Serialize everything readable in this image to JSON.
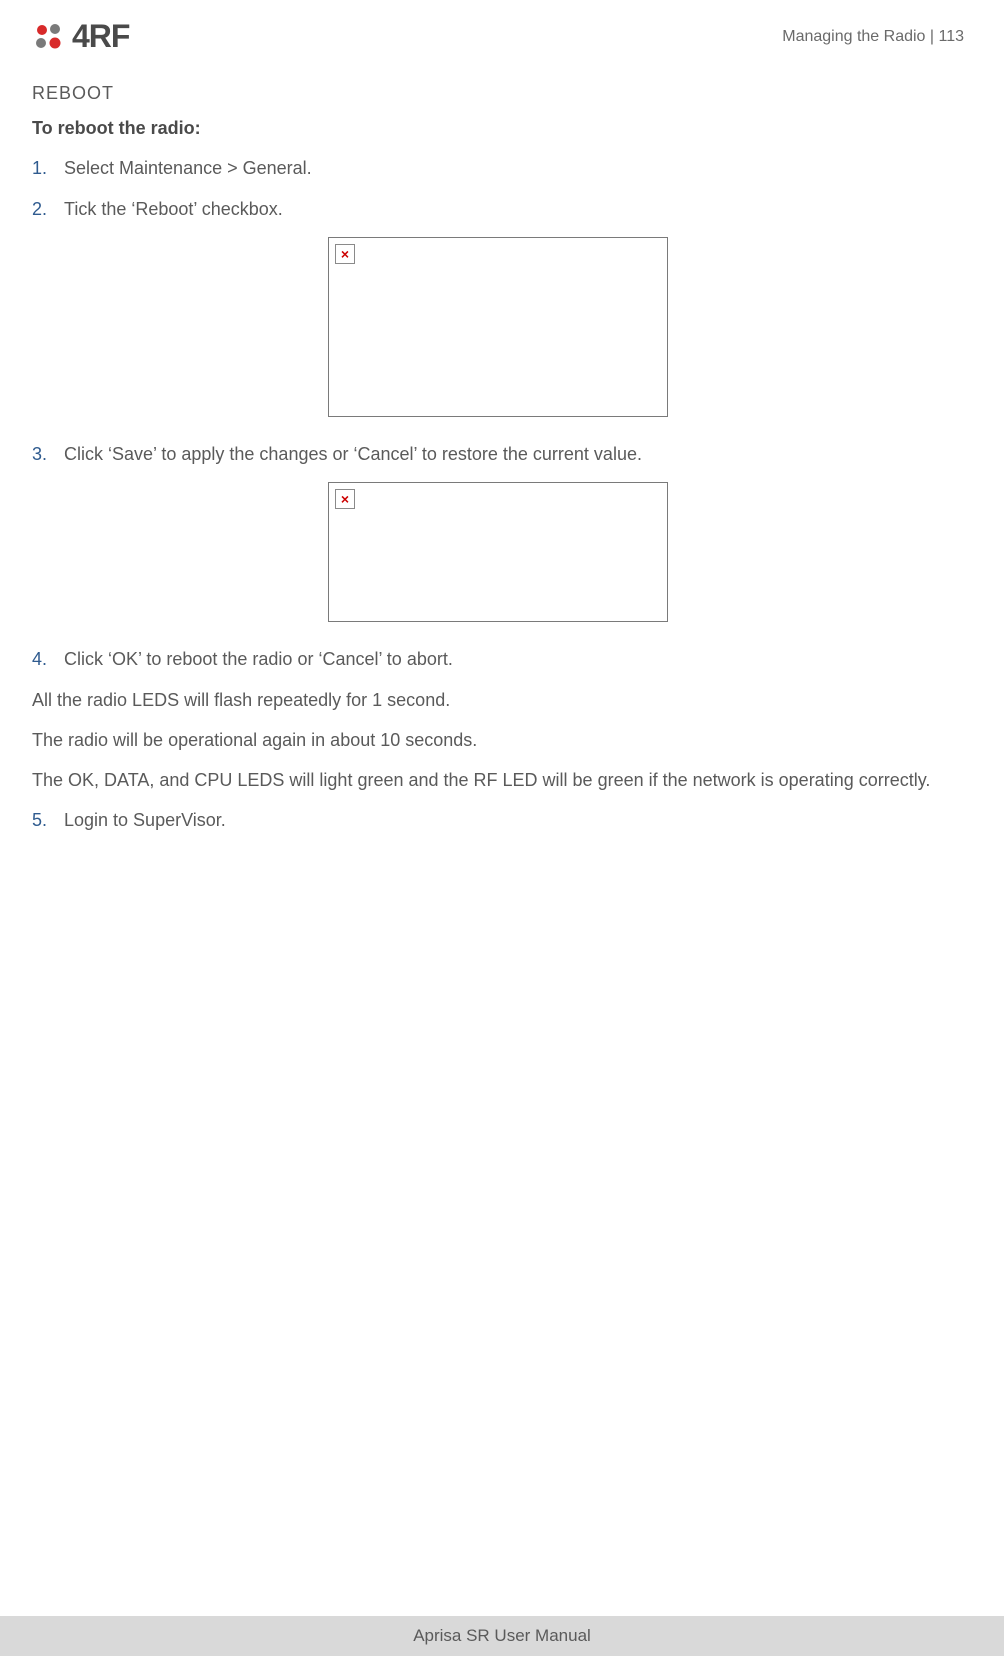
{
  "header": {
    "logo_text": "4RF",
    "breadcrumb": "Managing the Radio  |  113"
  },
  "content": {
    "section_title": "REBOOT",
    "sub_heading": "To reboot the radio:",
    "steps": [
      {
        "n": "1.",
        "t": "Select Maintenance > General."
      },
      {
        "n": "2.",
        "t": "Tick the ‘Reboot’ checkbox."
      }
    ],
    "step3": {
      "n": "3.",
      "t": "Click ‘Save’ to apply the changes or ‘Cancel’ to restore the current value."
    },
    "step4": {
      "n": "4.",
      "t": "Click ‘OK’ to reboot the radio or ‘Cancel’ to abort."
    },
    "para1": "All the radio LEDS will flash repeatedly for 1 second.",
    "para2": "The radio will be operational again in about 10 seconds.",
    "para3": "The OK, DATA, and CPU LEDS will light green and the RF LED will be green if the network is operating correctly.",
    "step5": {
      "n": "5.",
      "t": "Login to SuperVisor."
    },
    "broken_img_glyph": "×"
  },
  "footer": {
    "text": "Aprisa SR User Manual"
  }
}
